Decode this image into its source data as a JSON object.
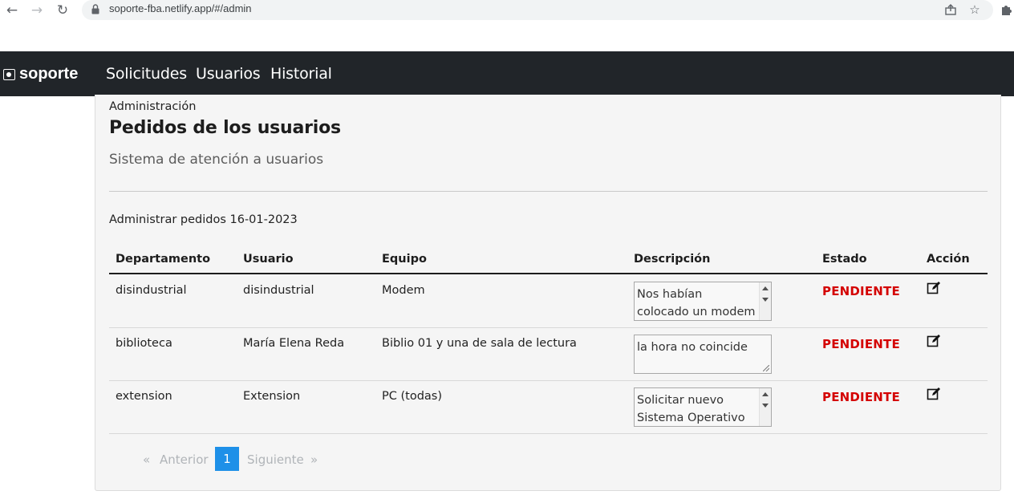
{
  "browser": {
    "url": "soporte-fba.netlify.app/#/admin"
  },
  "app": {
    "brand": "soporte",
    "nav": [
      "Solicitudes",
      "Usuarios",
      "Historial"
    ]
  },
  "page": {
    "breadcrumb": "Administración",
    "title": "Pedidos de los usuarios",
    "subtitle": "Sistema de atención a usuarios",
    "section_heading": "Administrar pedidos 16-01-2023"
  },
  "table": {
    "headers": [
      "Departamento",
      "Usuario",
      "Equipo",
      "Descripción",
      "Estado",
      "Acción"
    ],
    "rows": [
      {
        "departamento": "disindustrial",
        "usuario": "disindustrial",
        "equipo": "Modem",
        "descripcion": "Nos habían colocado un modem",
        "estado": "PENDIENTE"
      },
      {
        "departamento": "biblioteca",
        "usuario": "María Elena Reda",
        "equipo": "Biblio 01 y una de sala de lectura",
        "descripcion": "la hora no coincide",
        "estado": "PENDIENTE"
      },
      {
        "departamento": "extension",
        "usuario": "Extension",
        "equipo": "PC (todas)",
        "descripcion": "Solicitar nuevo Sistema Operativo",
        "estado": "PENDIENTE"
      }
    ]
  },
  "pagination": {
    "first": "«",
    "prev": "Anterior",
    "current": "1",
    "next": "Siguiente",
    "last": "»"
  },
  "colors": {
    "navbar": "#212529",
    "estado_pendiente": "#d40000",
    "pagination_active": "#1e90e8"
  },
  "icons": {
    "back": "arrow-left-icon",
    "forward": "arrow-right-icon",
    "reload": "reload-icon",
    "lock": "lock-icon",
    "share": "share-icon",
    "bookmark": "star-icon",
    "extensions": "puzzle-icon",
    "edit": "edit-icon"
  }
}
